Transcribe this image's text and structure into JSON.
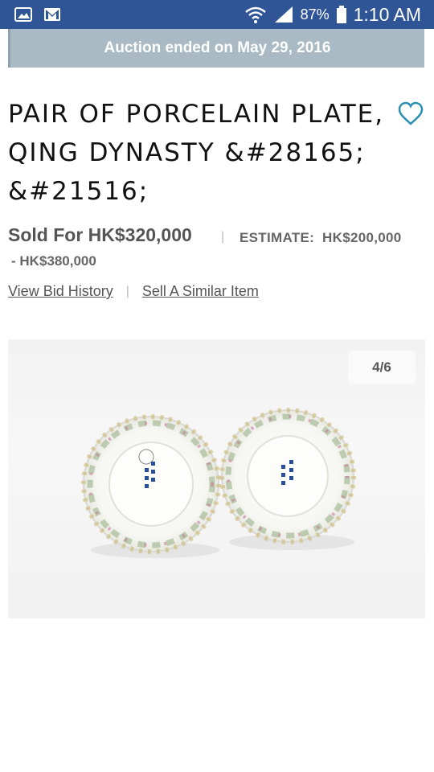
{
  "status_bar": {
    "battery": "87%",
    "time": "1:10 AM",
    "icons": [
      "image-icon",
      "gmail-icon",
      "wifi-icon",
      "signal-icon",
      "battery-icon"
    ]
  },
  "banner": {
    "text": "Auction ended on May 29, 2016"
  },
  "lot": {
    "title": "PAIR OF PORCELAIN PLATE, QING DYNASTY &#28165; &#21516;",
    "sold": "Sold For HK$320,000",
    "separator": "|",
    "estimate_label": "ESTIMATE:",
    "estimate_low": "HK$200,000",
    "estimate_high": "-  HK$380,000"
  },
  "links": {
    "bid_history": "View Bid History",
    "separator": "|",
    "sell_similar": "Sell A Similar Item"
  },
  "gallery": {
    "counter": "4/6"
  },
  "colors": {
    "status_bar": "#2f5597",
    "banner": "#a9bac4",
    "heart": "#2a8fb0"
  }
}
